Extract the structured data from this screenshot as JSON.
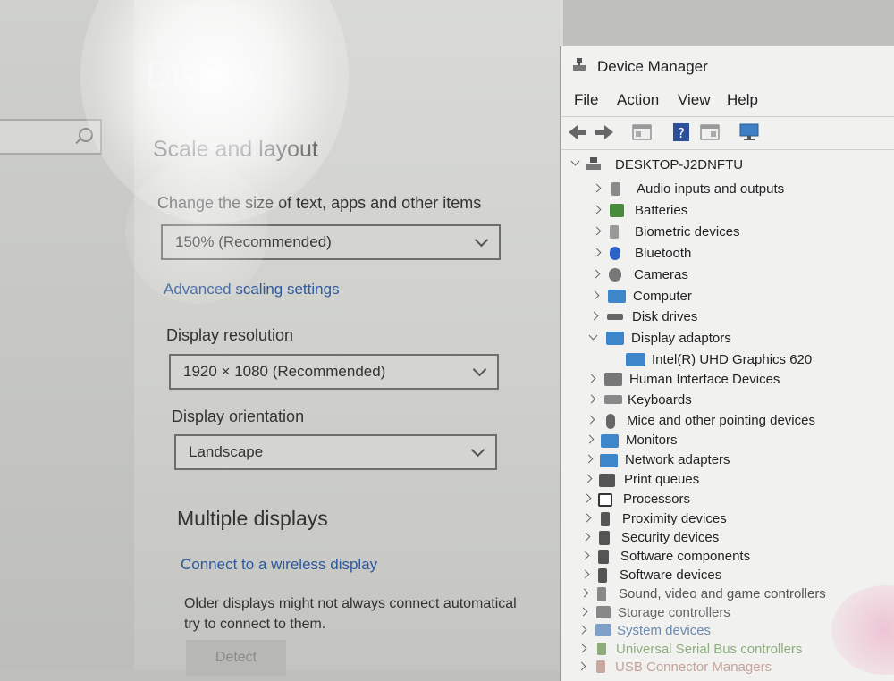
{
  "settings": {
    "page_title": "Display",
    "scale_section": "Scale and layout",
    "scale_label": "Change the size of text, apps and other items",
    "scale_value": "150% (Recommended)",
    "advanced_link": "Advanced scaling settings",
    "resolution_label": "Display resolution",
    "resolution_value": "1920 × 1080 (Recommended)",
    "orientation_label": "Display orientation",
    "orientation_value": "Landscape",
    "multi_section": "Multiple displays",
    "wireless_link": "Connect to a wireless display",
    "older_line1": "Older displays might not always connect automatical",
    "older_line2": "try to connect to them.",
    "detect_label": "Detect"
  },
  "device_manager": {
    "title": "Device Manager",
    "menu": [
      "File",
      "Action",
      "View",
      "Help"
    ],
    "root": "DESKTOP-J2DNFTU",
    "nodes": [
      {
        "label": "Audio inputs and outputs"
      },
      {
        "label": "Batteries"
      },
      {
        "label": "Biometric devices"
      },
      {
        "label": "Bluetooth"
      },
      {
        "label": "Cameras"
      },
      {
        "label": "Computer"
      },
      {
        "label": "Disk drives"
      },
      {
        "label": "Display adaptors",
        "expanded": true
      },
      {
        "label": "Intel(R) UHD Graphics 620",
        "child": true
      },
      {
        "label": "Human Interface Devices"
      },
      {
        "label": "Keyboards"
      },
      {
        "label": "Mice and other pointing devices"
      },
      {
        "label": "Monitors"
      },
      {
        "label": "Network adapters"
      },
      {
        "label": "Print queues"
      },
      {
        "label": "Processors"
      },
      {
        "label": "Proximity devices"
      },
      {
        "label": "Security devices"
      },
      {
        "label": "Software components"
      },
      {
        "label": "Software devices"
      },
      {
        "label": "Sound, video and game controllers"
      },
      {
        "label": "Storage controllers"
      },
      {
        "label": "System devices"
      },
      {
        "label": "Universal Serial Bus controllers"
      },
      {
        "label": "USB Connector Managers"
      }
    ]
  }
}
